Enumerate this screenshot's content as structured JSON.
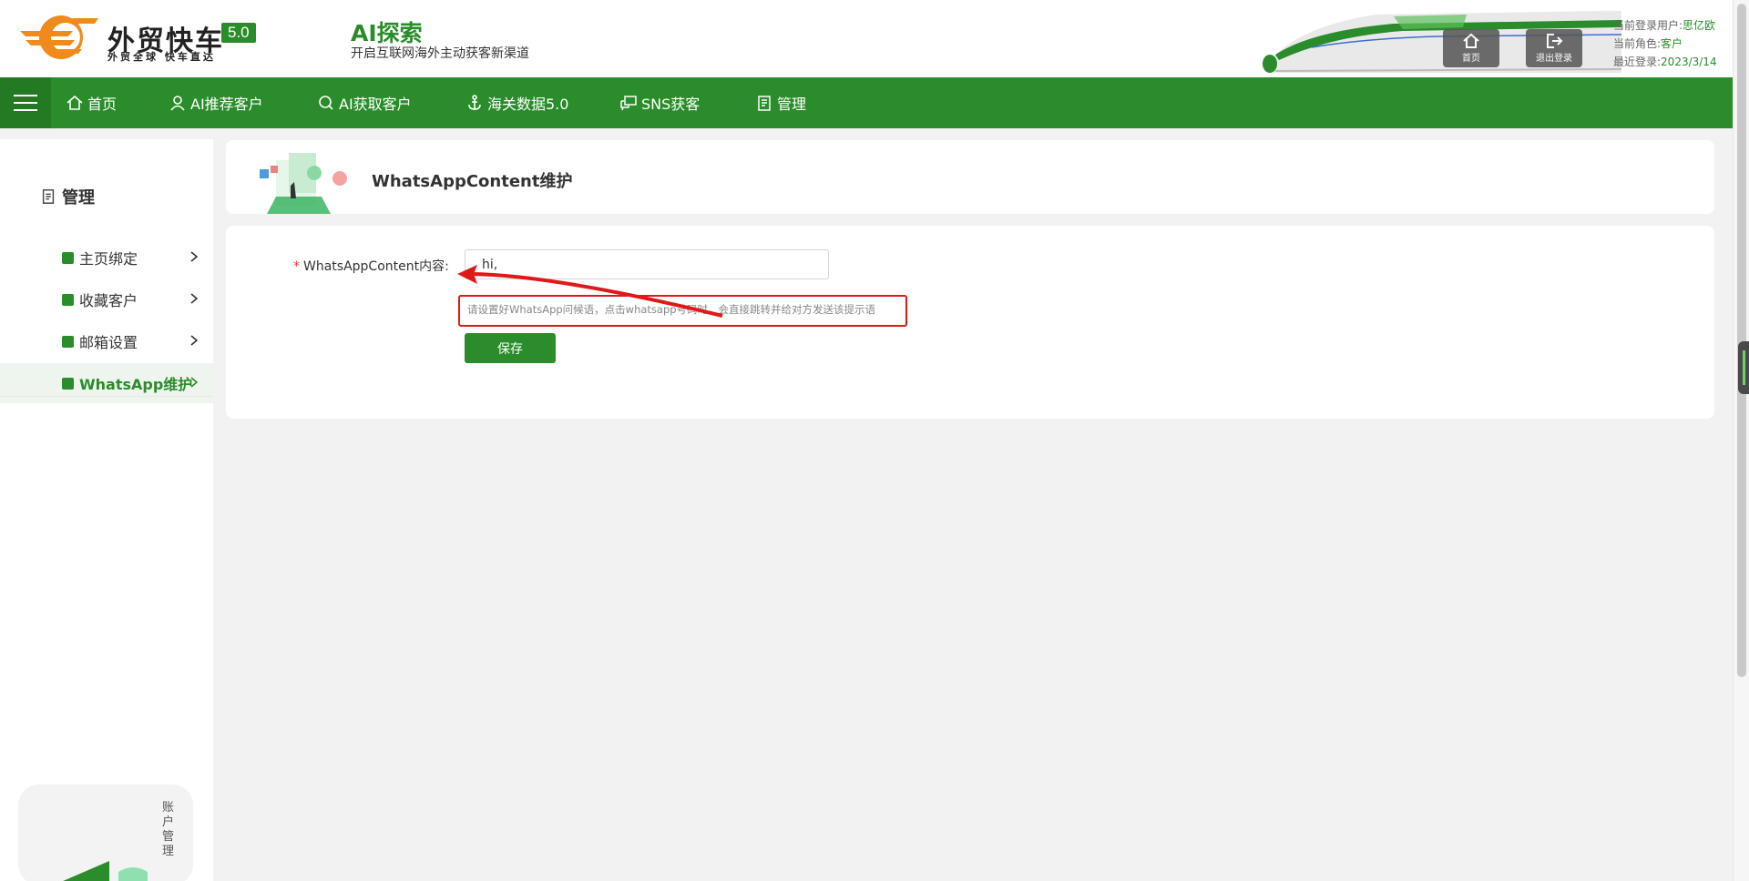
{
  "header": {
    "brand_title": "外贸快车",
    "brand_version": "5.0",
    "brand_subtitle": "外贸全球 快车直达",
    "ai_title": "AI探索",
    "ai_subtitle": "开启互联网海外主动获客新渠道",
    "home_label": "首页",
    "logout_label": "退出登录",
    "user_label": "当前登录用户:",
    "user_value": "思亿欧",
    "role_label": "当前角色:",
    "role_value": "客户",
    "last_login_label": "最近登录:",
    "last_login_value": "2023/3/14"
  },
  "nav": {
    "items": [
      {
        "label": "首页",
        "icon": "home-icon"
      },
      {
        "label": "AI推荐客户",
        "icon": "user-icon"
      },
      {
        "label": "AI获取客户",
        "icon": "search-icon"
      },
      {
        "label": "海关数据5.0",
        "icon": "anchor-icon"
      },
      {
        "label": "SNS获客",
        "icon": "chat-icon"
      },
      {
        "label": "管理",
        "icon": "document-icon"
      }
    ]
  },
  "sidebar": {
    "title": "管理",
    "items": [
      {
        "label": "主页绑定",
        "icon": "link-icon"
      },
      {
        "label": "收藏客户",
        "icon": "star-icon"
      },
      {
        "label": "邮箱设置",
        "icon": "mail-icon"
      },
      {
        "label": "WhatsApp维护",
        "icon": "edit-icon",
        "active": true
      }
    ],
    "account_label": "账户管理"
  },
  "main": {
    "page_title": "WhatsAppContent维护",
    "field_label": "WhatsAppContent内容:",
    "field_value": "hi,",
    "hint_text": "请设置好WhatsApp问候语，点击whatsapp号码时，会直接跳转并给对方发送该提示语",
    "save_label": "保存"
  },
  "colors": {
    "brand_green": "#2a8c2a",
    "accent_orange": "#f08a1a",
    "annotation_red": "#e01818"
  }
}
